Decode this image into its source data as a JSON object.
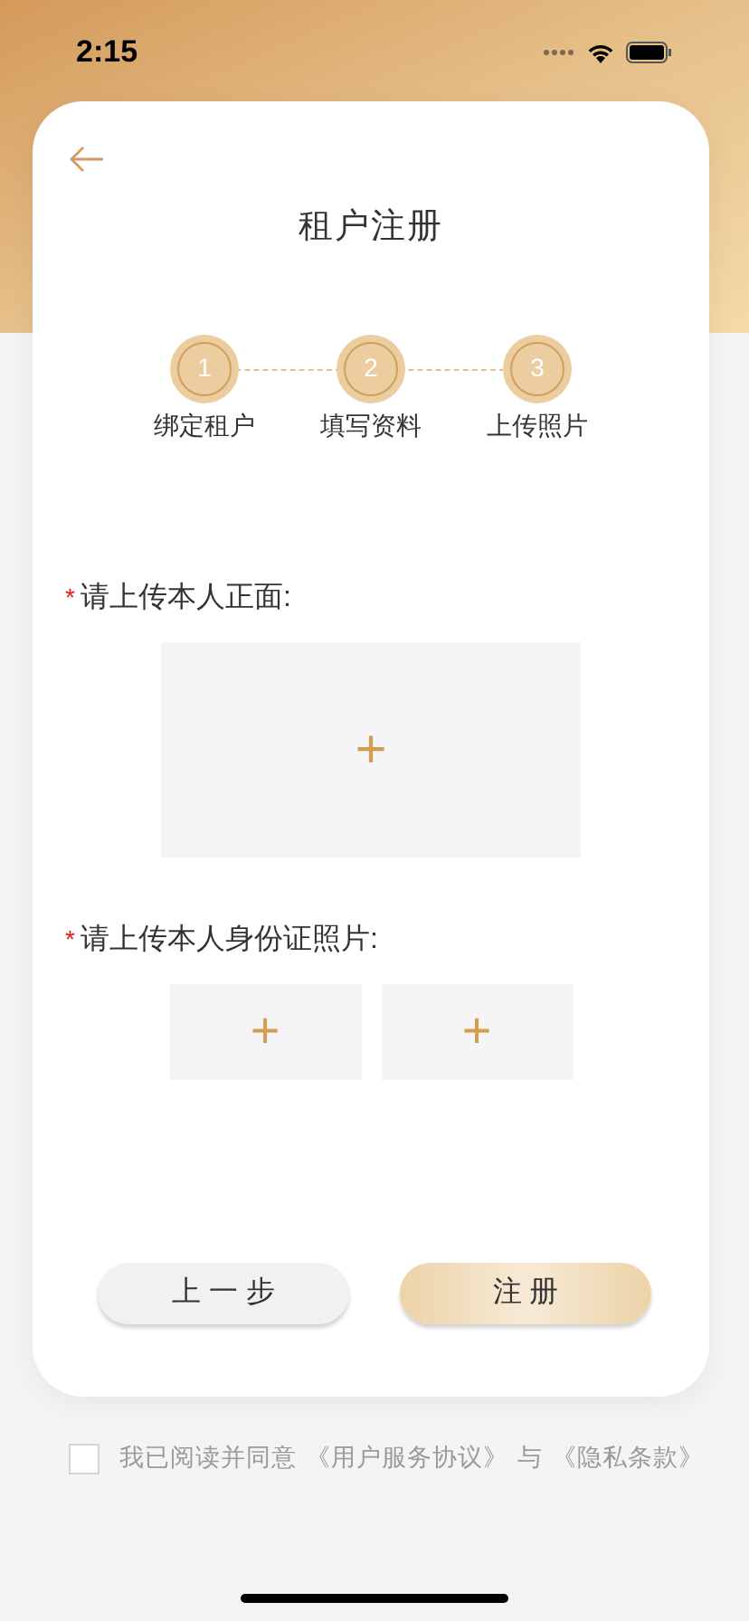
{
  "status_bar": {
    "time": "2:15"
  },
  "title": "租户注册",
  "steps": [
    {
      "number": "1",
      "label": "绑定租户"
    },
    {
      "number": "2",
      "label": "填写资料"
    },
    {
      "number": "3",
      "label": "上传照片"
    }
  ],
  "uploads": [
    {
      "required_mark": "*",
      "label": "请上传本人正面:",
      "slots": [
        {
          "kind": "large",
          "icon": "+"
        }
      ]
    },
    {
      "required_mark": "*",
      "label": "请上传本人身份证照片:",
      "slots": [
        {
          "kind": "small",
          "icon": "+"
        },
        {
          "kind": "small",
          "icon": "+"
        }
      ]
    }
  ],
  "buttons": [
    {
      "kind": "secondary",
      "label": "上 一 步"
    },
    {
      "kind": "primary",
      "label": "注 册"
    }
  ],
  "agreement": {
    "checked": false,
    "text": "我已阅读并同意",
    "link_1": "《用户服务协议》",
    "joiner": "与",
    "link_2": "《隐私条款》"
  }
}
